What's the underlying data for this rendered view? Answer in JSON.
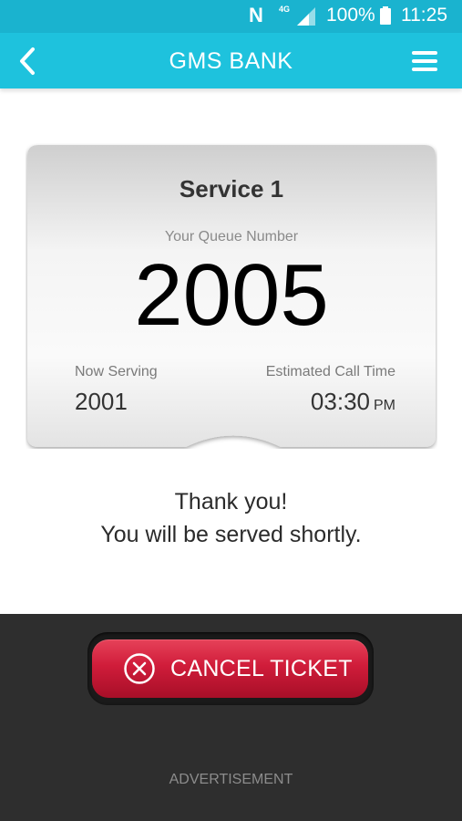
{
  "status_bar": {
    "carrier_icon": "N",
    "network": "4G",
    "battery": "100%",
    "time": "11:25"
  },
  "header": {
    "title": "GMS BANK",
    "back_icon": "chevron-left-icon",
    "menu_icon": "hamburger-menu-icon"
  },
  "ticket": {
    "service": "Service 1",
    "queue_label": "Your Queue Number",
    "queue_number": "2005",
    "now_serving_label": "Now Serving",
    "now_serving_value": "2001",
    "eta_label": "Estimated Call Time",
    "eta_time": "03:30",
    "eta_suffix": "PM"
  },
  "message": {
    "line1": "Thank you!",
    "line2": "You will be served shortly."
  },
  "footer": {
    "cancel_label": "CANCEL TICKET",
    "cancel_icon": "close-circle-icon",
    "advertisement": "ADVERTISEMENT"
  },
  "colors": {
    "status_bar": "#1ab3cf",
    "header": "#1ec2dd",
    "cancel_button": "#d01c3a",
    "bottom_panel": "#2e2e2e"
  }
}
